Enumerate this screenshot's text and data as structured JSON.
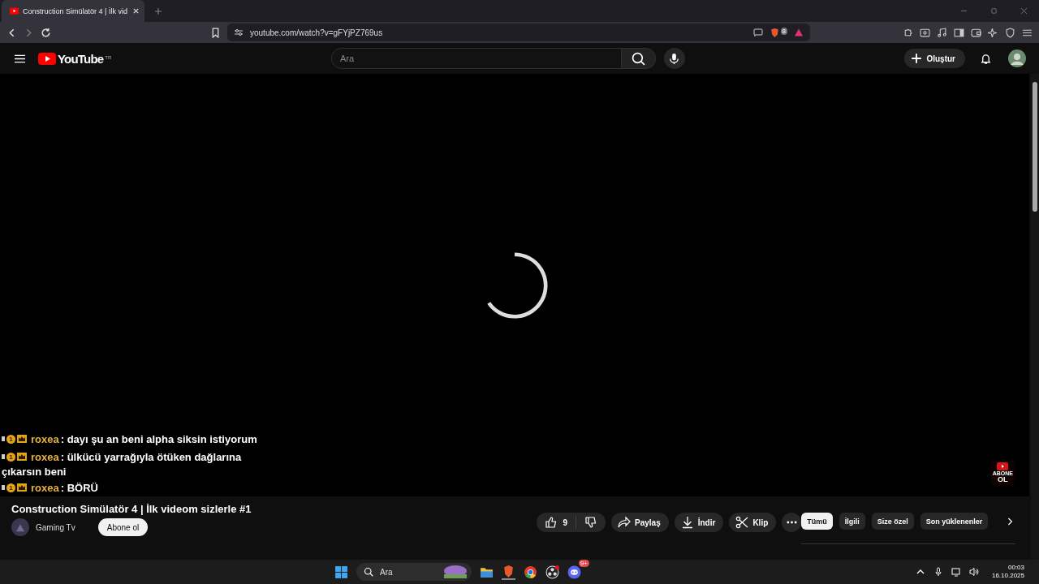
{
  "browser": {
    "tab": {
      "title": "Construction Simülatör 4 | İlk vid"
    },
    "url": "youtube.com/watch?v=gFYjPZ769us",
    "shields_count": "8"
  },
  "youtube": {
    "logo_text": "YouTube",
    "region": "TR",
    "search": {
      "placeholder": "Ara"
    },
    "create_label": "Oluştur"
  },
  "video": {
    "loading": true,
    "title": "Construction Simülatör 4 | İlk videom sizlerle #1",
    "channel": "Gaming Tv",
    "subscribe_label": "Abone ol",
    "like_count": "9",
    "actions": [
      "Paylaş",
      "İndir",
      "Klip"
    ],
    "watermark": [
      "ABONE",
      "OL"
    ]
  },
  "chat": [
    {
      "badge": "1",
      "user": "roxea",
      "sep": ":",
      "message": "dayı şu an beni alpha siksin istiyorum"
    },
    {
      "badge": "1",
      "user": "roxea",
      "sep": ":",
      "message": "ülkücü yarrağıyla ötüken dağlarına",
      "continuation": "çıkarsın beni"
    },
    {
      "badge": "1",
      "user": "roxea",
      "sep": ":",
      "message": "BÖRÜ"
    }
  ],
  "chips": [
    {
      "label": "Tümü",
      "selected": true
    },
    {
      "label": "İlgili",
      "selected": false
    },
    {
      "label": "Size özel",
      "selected": false
    },
    {
      "label": "Son yüklenenler",
      "selected": false
    }
  ],
  "taskbar": {
    "search_placeholder": "Ara",
    "discord_badge": "9+",
    "time": "00:03",
    "date": "16.10.2025"
  }
}
